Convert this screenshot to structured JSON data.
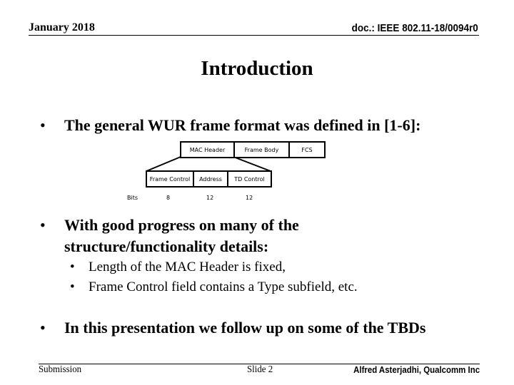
{
  "header": {
    "date": "January 2018",
    "doc_id": "doc.: IEEE 802.11-18/0094r0"
  },
  "slide": {
    "title": "Introduction",
    "bullets": [
      {
        "bullet": "•",
        "text": "The general WUR frame format was defined in [1-6]:"
      },
      {
        "bullet": "•",
        "line1": "With good progress on many of the",
        "line2": "structure/functionality details:"
      },
      {
        "bullet": "•",
        "text": "In this presentation we follow up on some of the TBDs"
      }
    ],
    "sub_bullets": [
      {
        "bullet": "•",
        "text": "Length of the MAC Header is fixed,"
      },
      {
        "bullet": "•",
        "text": "Frame Control field contains a Type subfield, etc."
      }
    ]
  },
  "diagram": {
    "frame_fields": [
      "MAC Header",
      "Frame Body",
      "FCS"
    ],
    "mac_header_fields": [
      "Frame Control",
      "Address",
      "TD Control"
    ],
    "bits_label": "Bits",
    "bits_values": [
      "8",
      "12",
      "12"
    ]
  },
  "footer": {
    "left": "Submission",
    "center": "Slide 2",
    "right": "Alfred Asterjadhi, Qualcomm Inc"
  }
}
